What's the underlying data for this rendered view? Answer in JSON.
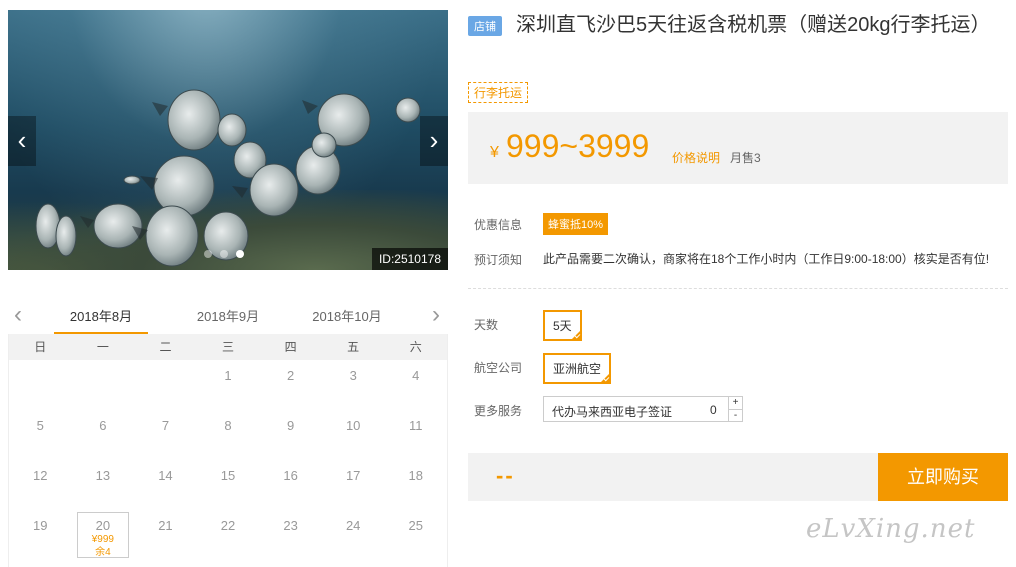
{
  "gallery": {
    "image_id": "ID:2510178",
    "prev_icon": "chevron-left-icon",
    "next_icon": "chevron-right-icon",
    "prev_glyph": "‹",
    "next_glyph": "›",
    "slide_count": 3,
    "active_slide": 3
  },
  "calendar": {
    "prev_glyph": "‹",
    "next_glyph": "›",
    "months": [
      "2018年8月",
      "2018年9月",
      "2018年10月"
    ],
    "active_month": 0,
    "weekdays": [
      "日",
      "一",
      "二",
      "三",
      "四",
      "五",
      "六"
    ],
    "weeks": [
      [
        "",
        "",
        "",
        "1",
        "2",
        "3",
        "4"
      ],
      [
        "5",
        "6",
        "7",
        "8",
        "9",
        "10",
        "11"
      ],
      [
        "12",
        "13",
        "14",
        "15",
        "16",
        "17",
        "18"
      ],
      [
        "19",
        "20",
        "21",
        "22",
        "23",
        "24",
        "25"
      ]
    ],
    "selected_day": {
      "day": "20",
      "price": "¥999",
      "stock": "余4"
    }
  },
  "product": {
    "shop_tag": "店铺",
    "title": "深圳直飞沙巴5天往返含税机票（赠送20kg行李托运）",
    "tag": "行李托运",
    "price_currency": "¥",
    "price_range": "999~3999",
    "price_explain": "价格说明",
    "monthly_sales": "月售3"
  },
  "info": {
    "discount_label": "优惠信息",
    "discount_badge": "蜂蜜抵10%",
    "notice_label": "预订须知",
    "notice_text": "此产品需要二次确认，商家将在18个工作小时内（工作日9:00-18:00）核实是否有位!"
  },
  "options": {
    "days_label": "天数",
    "days_value": "5天",
    "airline_label": "航空公司",
    "airline_value": "亚洲航空",
    "service_label": "更多服务",
    "service_name": "代办马来西亚电子签证",
    "service_qty": "0",
    "plus_glyph": "+",
    "minus_glyph": "-"
  },
  "buy": {
    "total": "--",
    "button_label": "立即购买"
  },
  "watermark": "eLvXing.net",
  "colors": {
    "accent": "#f39800",
    "shop_tag": "#6aa7e5",
    "panel_bg": "#f2f2f2"
  }
}
